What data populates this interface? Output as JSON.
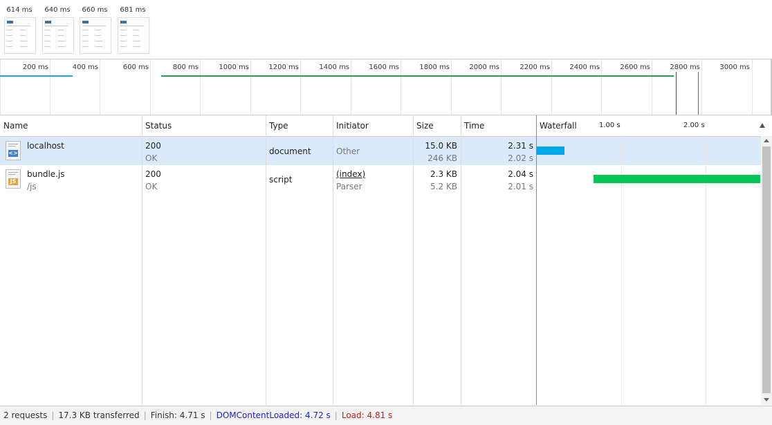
{
  "filmstrip": {
    "frames": [
      {
        "label": "614 ms"
      },
      {
        "label": "640 ms"
      },
      {
        "label": "660 ms"
      },
      {
        "label": "681 ms"
      }
    ]
  },
  "overview": {
    "ticks": [
      "200 ms",
      "400 ms",
      "600 ms",
      "800 ms",
      "1000 ms",
      "1200 ms",
      "1400 ms",
      "1600 ms",
      "1800 ms",
      "2000 ms",
      "2200 ms",
      "2400 ms",
      "2600 ms",
      "2800 ms",
      "3000 ms"
    ],
    "colors": {
      "document": "#1ea1e6",
      "script": "#1da64b",
      "dom_content_loaded": "#3a3ad6",
      "load": "#d84040"
    }
  },
  "table": {
    "headers": {
      "name": "Name",
      "status": "Status",
      "type": "Type",
      "initiator": "Initiator",
      "size": "Size",
      "time": "Time",
      "waterfall": "Waterfall"
    },
    "waterfall_ticks": [
      "1.00 s",
      "2.00 s"
    ],
    "rows": [
      {
        "name": "localhost",
        "path": "",
        "icon": "html-document-icon",
        "status_code": "200",
        "status_text": "OK",
        "type": "document",
        "initiator": "Other",
        "initiator_sub": "",
        "size": "15.0 KB",
        "size_sub": "246 KB",
        "time": "2.31 s",
        "time_sub": "2.02 s",
        "bar_color": "#00a6e8"
      },
      {
        "name": "bundle.js",
        "path": "/js",
        "icon": "js-file-icon",
        "status_code": "200",
        "status_text": "OK",
        "type": "script",
        "initiator": "(index)",
        "initiator_sub": "Parser",
        "size": "2.3 KB",
        "size_sub": "5.2 KB",
        "time": "2.04 s",
        "time_sub": "2.01 s",
        "bar_color": "#00c853"
      }
    ]
  },
  "status_bar": {
    "requests": "2 requests",
    "transferred": "17.3 KB transferred",
    "finish": "Finish: 4.71 s",
    "dom_content_loaded": "DOMContentLoaded: 4.72 s",
    "load": "Load: 4.81 s"
  }
}
